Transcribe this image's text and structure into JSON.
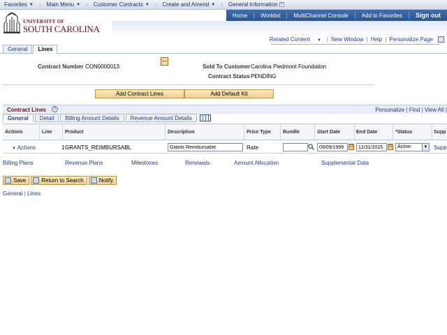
{
  "topnav": {
    "favorites": "Favorites",
    "main_menu": "Main Menu",
    "customer_contracts": "Customer Contracts",
    "create_amend": "Create and Amend",
    "general_info": "General Information"
  },
  "header": {
    "univ": "UNIVERSITY OF",
    "sc": "SOUTH CAROLINA",
    "links": {
      "home": "Home",
      "worklist": "Worklist",
      "multichannel": "MultiChannel Console",
      "favorites": "Add to Favorites",
      "signout": "Sign out"
    }
  },
  "related": {
    "content": "Related Content",
    "new_window": "New Window",
    "help": "Help",
    "personalize": "Personalize Page"
  },
  "page_tabs": {
    "general": "General",
    "lines": "Lines"
  },
  "contract": {
    "number_label": "Contract Number",
    "number": "CON0000013",
    "sold_label": "Sold To Customer",
    "sold": "Carolina Piedmont Foundation",
    "status_label": "Contract Status",
    "status": "PENDING"
  },
  "buttons": {
    "add_lines": "Add Contract Lines",
    "add_kit": "Add Default Kit"
  },
  "lines": {
    "title": "Contract Lines",
    "personalize": "Personalize",
    "find": "Find",
    "view_all": "View All",
    "tabs": {
      "general": "General",
      "detail": "Detail",
      "billing": "Billing Amount Details",
      "revenue": "Revenue Amount Details"
    },
    "headers": {
      "actions": "Actions",
      "line": "Line",
      "product": "Product",
      "description": "Description",
      "price_type": "Price Type",
      "bundle": "Bundle",
      "start_date": "Start Date",
      "end_date": "End Date",
      "status": "*Status",
      "supp": "Supp"
    },
    "row": {
      "actions": "Actions",
      "line": "1",
      "product": "GRANTS_REIMBURSABL",
      "description": "Grants Reimbursable",
      "price_type": "Rate",
      "bundle": "",
      "start_date": "09/09/1999",
      "end_date": "12/31/2015",
      "status": "Active",
      "supp": "Supp"
    }
  },
  "sublinks": {
    "billing_plans": "Billing Plans",
    "revenue_plans": "Revenue Plans",
    "milestones": "Milestones",
    "renewals": "Renewals",
    "amount_allocation": "Amount Allocation",
    "supplemental": "Supplemental Data"
  },
  "actions": {
    "save": "Save",
    "return": "Return to Search",
    "notify": "Notify"
  },
  "footer": {
    "general": "General",
    "lines": "Lines"
  }
}
